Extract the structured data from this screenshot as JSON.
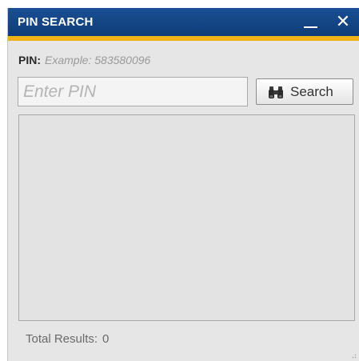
{
  "window": {
    "title": "PIN SEARCH",
    "minimize_label": "",
    "close_label": "✕"
  },
  "form": {
    "pin_label": "PIN:",
    "pin_example": "Example: 583580096",
    "input_placeholder": "Enter PIN",
    "input_value": "",
    "search_button_label": "Search"
  },
  "results": {
    "total_label": "Total Results:",
    "total_count": "0",
    "items": []
  },
  "colors": {
    "titlebar": "#0f3c78",
    "accent_stripe": "#f0b116",
    "panel_background": "#e6e6e6"
  },
  "icons": {
    "search_button_icon": "binoculars-icon"
  }
}
